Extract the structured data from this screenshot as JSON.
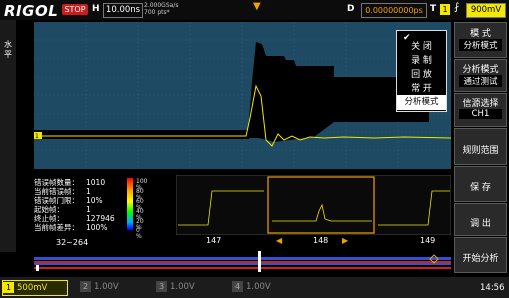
{
  "brand": "RIGOL",
  "status": "STOP",
  "horizontal": {
    "label": "H",
    "timebase": "10.00ns",
    "sample_rate": "2.000GSa/s",
    "memory": "700 pts*"
  },
  "delay": {
    "label": "D",
    "value": "0.00000000ps"
  },
  "trigger": {
    "label": "T",
    "source": "1",
    "level": "900mV"
  },
  "left_strip_label": "水\n平",
  "popup": {
    "items": [
      "关 闭",
      "录 制",
      "回 放",
      "常 开"
    ],
    "selected": "分析模式",
    "check": "✔"
  },
  "analysis": {
    "rows": [
      {
        "label": "错误帧数量：",
        "value": "1010"
      },
      {
        "label": "当前错误帧：",
        "value": "1"
      },
      {
        "label": "错误帧门限：",
        "value": "10%"
      },
      {
        "label": "起始帧：",
        "value": "1"
      },
      {
        "label": "终止帧：",
        "value": "127946"
      },
      {
        "label": "当前帧差异：",
        "value": "100%"
      }
    ],
    "color_scale": [
      "100 %",
      "80 %",
      "60 %",
      "40 %",
      "20 %",
      "0 %"
    ]
  },
  "thumbnails": {
    "frames": [
      "147",
      "148",
      "149"
    ],
    "prev_arrow": "◀",
    "next_arrow": "▶"
  },
  "frame_range": "32~264",
  "right_menu": {
    "mode_title": "模 式",
    "mode_value": "分析模式",
    "analysis_title": "分析模式",
    "analysis_value": "通过测试",
    "source_title": "信源选择",
    "source_value": "CH1",
    "button_range": "规则范围",
    "button_save": "保 存",
    "button_load": "调 出",
    "button_start": "开始分析"
  },
  "channels": [
    {
      "num": "1",
      "scale": "500mV",
      "active": true
    },
    {
      "num": "2",
      "scale": "1.00V",
      "active": false
    },
    {
      "num": "3",
      "scale": "1.00V",
      "active": false
    },
    {
      "num": "4",
      "scale": "1.00V",
      "active": false
    }
  ],
  "clock": "14:56",
  "colors": {
    "ch1": "#f2e800",
    "accent": "#f2a100",
    "wave_bg": "#1e4a63"
  }
}
